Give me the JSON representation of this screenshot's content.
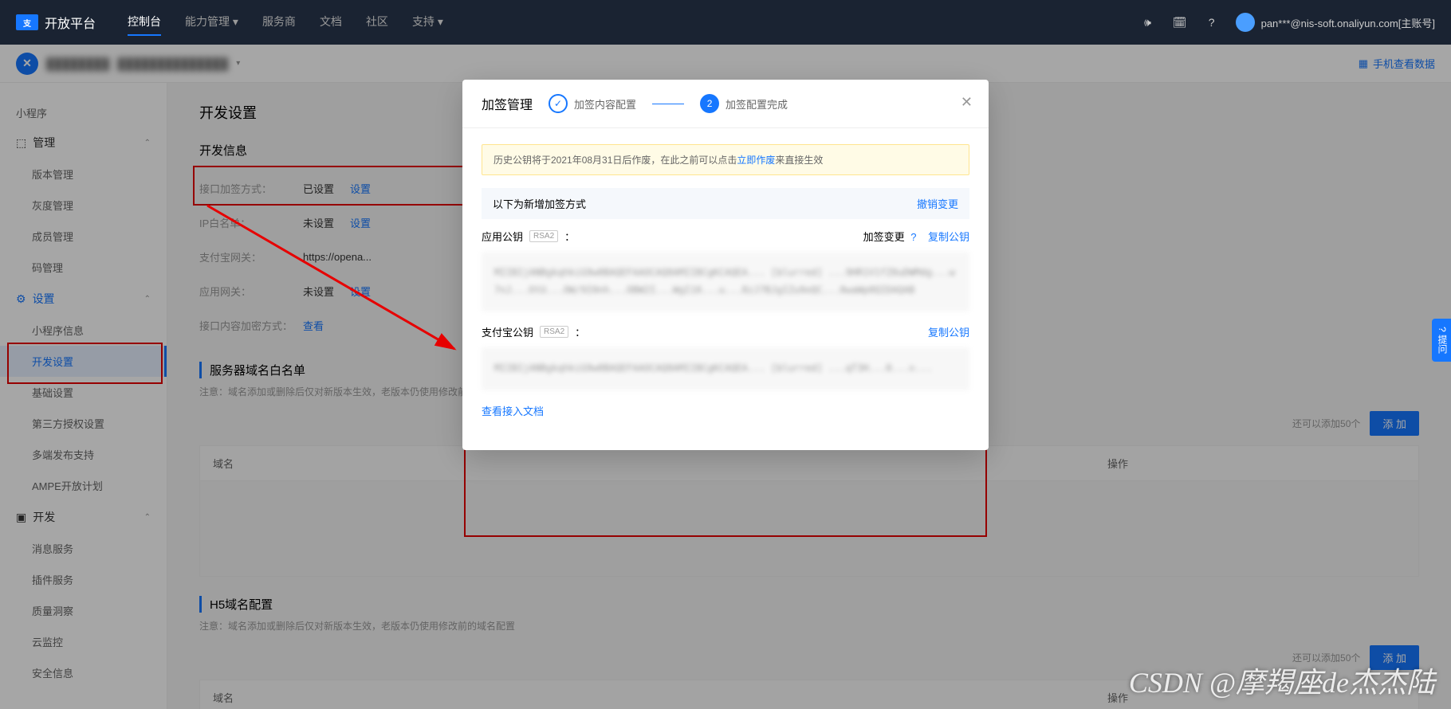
{
  "header": {
    "logo_text": "开放平台",
    "logo_sub": "支付宝",
    "nav": [
      "控制台",
      "能力管理",
      "服务商",
      "文档",
      "社区",
      "支持"
    ],
    "user": "pan***@nis-soft.onaliyun.com[主账号]"
  },
  "sub_header": {
    "app_name_blur": "████████",
    "app_id_blur": "██████████████",
    "phone_link": "手机查看数据"
  },
  "sidebar": {
    "root": "小程序",
    "groups": [
      {
        "label": "管理",
        "icon": "cube",
        "items": [
          "版本管理",
          "灰度管理",
          "成员管理",
          "码管理"
        ]
      },
      {
        "label": "设置",
        "icon": "gear",
        "items": [
          "小程序信息",
          "开发设置",
          "基础设置",
          "第三方授权设置",
          "多端发布支持",
          "AMPE开放计划"
        ],
        "active_item": "开发设置",
        "active": true
      },
      {
        "label": "开发",
        "icon": "code",
        "items": [
          "消息服务",
          "插件服务",
          "质量洞察",
          "云监控",
          "安全信息"
        ]
      }
    ]
  },
  "content": {
    "page_title": "开发设置",
    "dev_info": {
      "title": "开发信息",
      "rows": [
        {
          "label": "接口加签方式：",
          "value": "已设置",
          "action": "设置"
        },
        {
          "label": "IP白名单：",
          "value": "未设置",
          "action": "设置"
        },
        {
          "label": "支付宝网关：",
          "value": "https://opena...",
          "action": ""
        },
        {
          "label": "应用网关：",
          "value": "未设置",
          "action": "设置"
        },
        {
          "label": "接口内容加密方式：",
          "value": "",
          "action": "查看"
        }
      ]
    },
    "server_domain": {
      "title": "服务器域名白名单",
      "note": "注意：域名添加或删除后仅对新版本生效，老版本仍使用修改前...",
      "quota": "还可以添加50个",
      "add_btn": "添 加",
      "columns": [
        "域名",
        "操作"
      ]
    },
    "h5_domain": {
      "title": "H5域名配置",
      "note": "注意：域名添加或删除后仅对新版本生效，老版本仍使用修改前的域名配置",
      "quota": "还可以添加50个",
      "add_btn": "添 加",
      "columns": [
        "域名",
        "操作"
      ]
    }
  },
  "modal": {
    "title": "加签管理",
    "step1": "加签内容配置",
    "step2": "加签配置完成",
    "notice_prefix": "历史公钥将于2021年08月31日后作废，在此之前可以点击",
    "notice_link": "立即作废",
    "notice_suffix": "来直接生效",
    "sub_bar_left": "以下为新增加签方式",
    "sub_bar_right": "撤销变更",
    "app_key_label": "应用公钥",
    "rsa_tag": "RSA2",
    "sign_change": "加签变更",
    "copy_key": "复制公钥",
    "app_key_text": "MIIBIjANBgkqhkiG9w0BAQEFAAOCAQ8AMIIBCgKCAQEA... [blurred] ...9HR1V1fZ0uDWMdg...w7nJ...OtU...OW/9I0nh...OBW2I...WgI10...u...8zJ7BJgIZu9oQC...0waWp0QIDAQAB",
    "alipay_key_label": "支付宝公钥",
    "alipay_key_text": "MIIBIjANBgkqhkiG9w0BAQEFAAOCAQ8AMIIBCgKCAQEA... [blurred] ...qT3H...0...v...",
    "doc_link": "查看接入文档"
  },
  "side_tab": "提问",
  "watermark": "CSDN @摩羯座de杰杰陆"
}
